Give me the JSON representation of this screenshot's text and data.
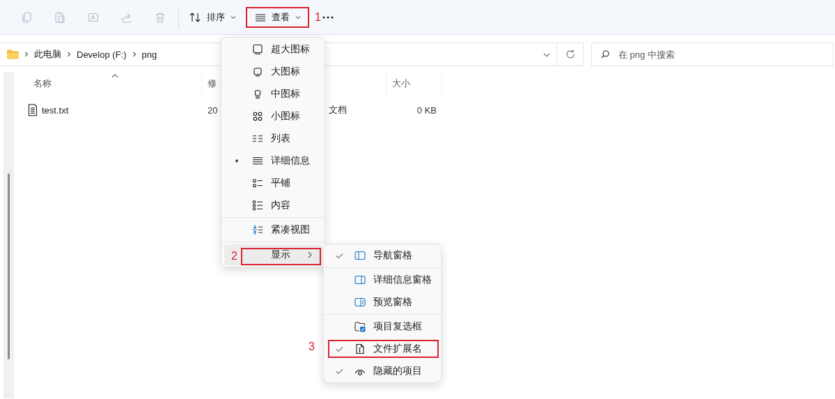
{
  "toolbar": {
    "icon_buttons": [
      {
        "kind": "copy",
        "disabled": true
      },
      {
        "kind": "paste",
        "disabled": true
      },
      {
        "kind": "rename",
        "disabled": true
      },
      {
        "kind": "share",
        "disabled": true
      },
      {
        "kind": "delete",
        "disabled": true
      }
    ],
    "sort_button": {
      "label": "排序"
    },
    "view_button": {
      "label": "查看",
      "annotation": "1"
    }
  },
  "address_bar": {
    "breadcrumbs": [
      "此电脑",
      "Develop (F:)",
      "png"
    ]
  },
  "search": {
    "placeholder": "在 png 中搜索"
  },
  "table": {
    "columns": [
      {
        "label": "名称",
        "sorted": true
      },
      {
        "label": "修",
        "sorted": false
      },
      {
        "sorted": false
      },
      {
        "label": "大小",
        "sorted": false
      }
    ],
    "rows": [
      {
        "cells": [
          "test.txt",
          "20",
          "文档",
          "0 KB"
        ]
      }
    ]
  },
  "view_menu": {
    "groups": [
      {
        "items": [
          {
            "kind": "extra-large",
            "label": "超大图标",
            "selected": false,
            "highlighted": false
          },
          {
            "kind": "large",
            "label": "大图标",
            "selected": false,
            "highlighted": false
          },
          {
            "kind": "medium",
            "label": "中图标",
            "selected": false,
            "highlighted": false
          },
          {
            "kind": "small",
            "label": "小图标",
            "selected": false,
            "highlighted": false
          },
          {
            "kind": "list",
            "label": "列表",
            "selected": false,
            "highlighted": false
          },
          {
            "kind": "details",
            "label": "详细信息",
            "selected": true,
            "highlighted": false
          },
          {
            "kind": "tiles",
            "label": "平铺",
            "selected": false,
            "highlighted": false
          },
          {
            "kind": "content",
            "label": "内容",
            "selected": false,
            "highlighted": false
          }
        ]
      },
      {
        "items": [
          {
            "kind": "compact",
            "label": "紧凑视图",
            "selected": false,
            "highlighted": false
          }
        ]
      },
      {
        "items": [
          {
            "kind": "submenu",
            "label": "显示",
            "selected": false,
            "highlighted": true,
            "annotation": "2"
          }
        ]
      }
    ]
  },
  "show_menu": {
    "groups": [
      {
        "items": [
          {
            "kind": "navigation-pane",
            "label": "导航窗格",
            "checked": true
          }
        ]
      },
      {
        "items": [
          {
            "kind": "details-pane",
            "label": "详细信息窗格",
            "checked": false
          },
          {
            "kind": "preview-pane",
            "label": "预览窗格",
            "checked": false
          }
        ]
      },
      {
        "items": [
          {
            "kind": "item-checkboxes",
            "label": "项目复选框",
            "checked": false
          },
          {
            "kind": "file-extensions",
            "label": "文件扩展名",
            "checked": true,
            "annotation": "3"
          },
          {
            "kind": "hidden-items",
            "label": "隐藏的项目",
            "checked": true
          }
        ]
      }
    ]
  }
}
